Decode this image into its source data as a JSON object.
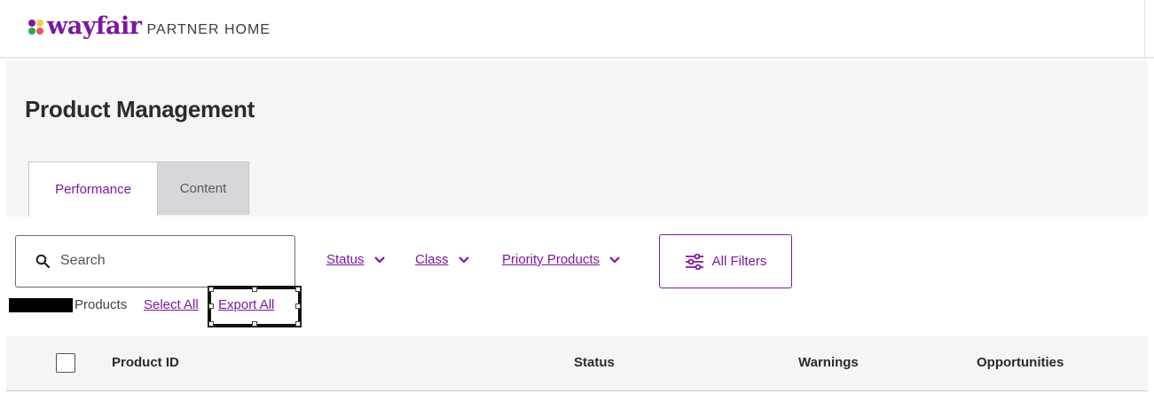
{
  "header": {
    "brand": "wayfair",
    "subtitle": "PARTNER HOME",
    "logo_colors": [
      "#7b189f",
      "#f2c94c",
      "#2fa84f",
      "#eb5757"
    ]
  },
  "page": {
    "title": "Product Management"
  },
  "tabs": [
    {
      "label": "Performance",
      "active": true
    },
    {
      "label": "Content",
      "active": false
    }
  ],
  "search": {
    "placeholder": "Search",
    "icon": "search-icon"
  },
  "filters": [
    {
      "label": "Status",
      "icon": "chevron-down-icon"
    },
    {
      "label": "Class",
      "icon": "chevron-down-icon"
    },
    {
      "label": "Priority Products",
      "icon": "chevron-down-icon"
    }
  ],
  "all_filters": {
    "label": "All Filters",
    "icon": "sliders-icon"
  },
  "summary": {
    "products_label": "Products",
    "select_all": "Select All",
    "export_all": "Export All"
  },
  "table": {
    "columns": [
      "Product ID",
      "Status",
      "Warnings",
      "Opportunities"
    ]
  },
  "colors": {
    "accent": "#7b189f",
    "band": "#f5f5f5",
    "tab_inactive": "#d8d6db"
  }
}
